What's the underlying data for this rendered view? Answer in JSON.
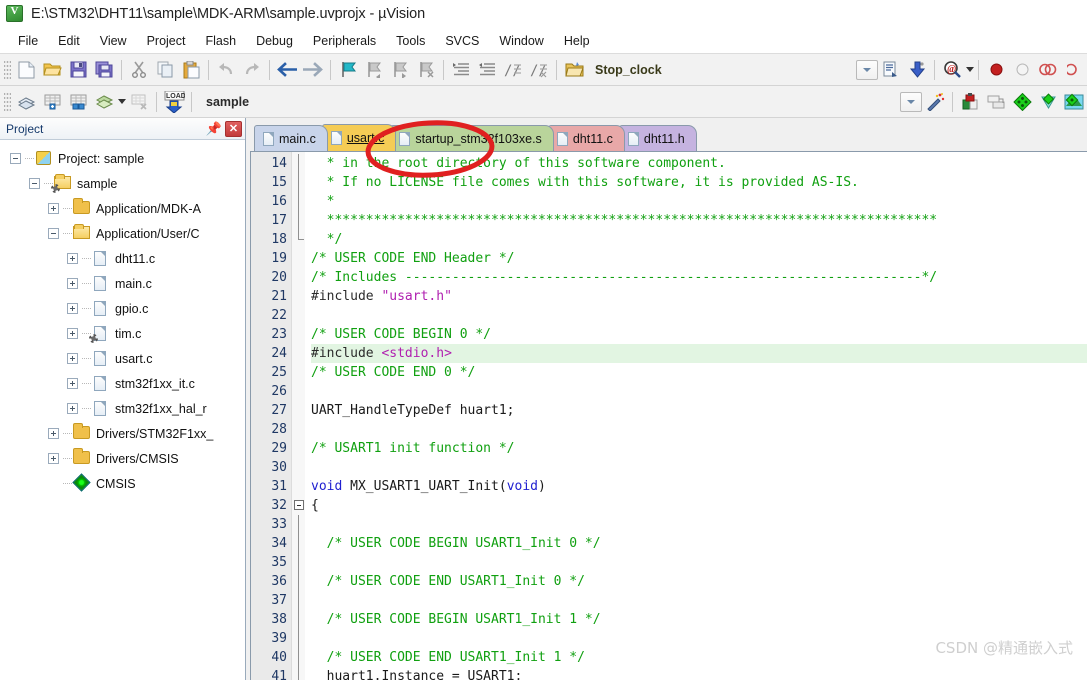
{
  "window": {
    "title": "E:\\STM32\\DHT11\\sample\\MDK-ARM\\sample.uvprojx - µVision",
    "app_icon": "uvision-logo-icon"
  },
  "menubar": {
    "items": [
      "File",
      "Edit",
      "View",
      "Project",
      "Flash",
      "Debug",
      "Peripherals",
      "Tools",
      "SVCS",
      "Window",
      "Help"
    ]
  },
  "toolbar_row1": {
    "icons": [
      "new-file-icon",
      "open-folder-icon",
      "save-icon",
      "save-all-icon",
      "cut-icon",
      "copy-icon",
      "paste-icon",
      "undo-icon",
      "redo-icon",
      "navigate-back-icon",
      "navigate-forward-icon",
      "bookmark-toggle-icon",
      "bookmark-prev-icon",
      "bookmark-next-icon",
      "bookmark-clear-icon",
      "indent-icon",
      "outdent-icon",
      "comment-icon",
      "uncomment-icon",
      "target-options-icon"
    ],
    "target_label": "Stop_clock",
    "combo_chevron": "chevron-down-icon",
    "right_icons": [
      "build-output-icon",
      "download-icon",
      "find-in-files-icon",
      "debug-start-icon",
      "debug-reset-icon",
      "breakpoint-icon"
    ]
  },
  "toolbar_row2": {
    "icons": [
      "build-icon",
      "build-target-icon",
      "rebuild-icon",
      "batch-build-icon",
      "stop-build-icon",
      "load-icon"
    ],
    "load_label": "LOAD",
    "target_name": "sample",
    "right_icons": [
      "magic-wand-icon",
      "manage-project-items-icon",
      "multi-project-icon",
      "pack-installer-icon",
      "configuration-wizard-icon",
      "rte-manager-icon"
    ]
  },
  "project_pane": {
    "title": "Project",
    "pin_icon": "pin-icon",
    "close_icon": "close-icon",
    "tree": [
      {
        "label": "Project: sample",
        "depth": 0,
        "icon": "project-icon",
        "expander": "minus"
      },
      {
        "label": "sample",
        "depth": 1,
        "icon": "folder-open-icon",
        "expander": "minus",
        "gear": true
      },
      {
        "label": "Application/MDK-A",
        "depth": 2,
        "icon": "folder-icon",
        "expander": "plus"
      },
      {
        "label": "Application/User/C",
        "depth": 2,
        "icon": "folder-open-icon",
        "expander": "minus"
      },
      {
        "label": "dht11.c",
        "depth": 3,
        "icon": "file-icon",
        "expander": "plus"
      },
      {
        "label": "main.c",
        "depth": 3,
        "icon": "file-icon",
        "expander": "plus"
      },
      {
        "label": "gpio.c",
        "depth": 3,
        "icon": "file-icon",
        "expander": "plus"
      },
      {
        "label": "tim.c",
        "depth": 3,
        "icon": "file-icon",
        "expander": "plus",
        "gear": true
      },
      {
        "label": "usart.c",
        "depth": 3,
        "icon": "file-icon",
        "expander": "plus"
      },
      {
        "label": "stm32f1xx_it.c",
        "depth": 3,
        "icon": "file-icon",
        "expander": "plus"
      },
      {
        "label": "stm32f1xx_hal_r",
        "depth": 3,
        "icon": "file-icon",
        "expander": "plus"
      },
      {
        "label": "Drivers/STM32F1xx_",
        "depth": 2,
        "icon": "folder-icon",
        "expander": "plus"
      },
      {
        "label": "Drivers/CMSIS",
        "depth": 2,
        "icon": "folder-icon",
        "expander": "plus"
      },
      {
        "label": "CMSIS",
        "depth": 2,
        "icon": "cmsis-diamond-icon",
        "expander": "none"
      }
    ]
  },
  "editor": {
    "tabs": [
      {
        "label": "main.c",
        "active": false,
        "color": "#c8d4ea"
      },
      {
        "label": "usart.c",
        "active": true,
        "color": "#f5cc55"
      },
      {
        "label": "startup_stm32f103xe.s",
        "active": false,
        "color": "#b9d49b"
      },
      {
        "label": "dht11.c",
        "active": false,
        "color": "#e8a8a8"
      },
      {
        "label": "dht11.h",
        "active": false,
        "color": "#c5b3e0"
      }
    ],
    "first_line": 14,
    "highlight_line": 24,
    "lines": [
      {
        "n": 14,
        "fold": "bar",
        "tokens": [
          {
            "t": "  * in the root directory of this software component.",
            "c": "c-cmt"
          }
        ]
      },
      {
        "n": 15,
        "fold": "bar",
        "tokens": [
          {
            "t": "  * If no LICENSE file comes with this software, it is provided AS-IS.",
            "c": "c-cmt"
          }
        ]
      },
      {
        "n": 16,
        "fold": "bar",
        "tokens": [
          {
            "t": "  *",
            "c": "c-cmt"
          }
        ]
      },
      {
        "n": 17,
        "fold": "bar",
        "tokens": [
          {
            "t": "  ******************************************************************************",
            "c": "c-cmt"
          }
        ]
      },
      {
        "n": 18,
        "fold": "end",
        "tokens": [
          {
            "t": "  */",
            "c": "c-cmt"
          }
        ]
      },
      {
        "n": 19,
        "fold": "none",
        "tokens": [
          {
            "t": "/* USER CODE END Header */",
            "c": "c-cmt"
          }
        ]
      },
      {
        "n": 20,
        "fold": "none",
        "tokens": [
          {
            "t": "/* Includes ------------------------------------------------------------------*/",
            "c": "c-cmt"
          }
        ]
      },
      {
        "n": 21,
        "fold": "none",
        "tokens": [
          {
            "t": "#include ",
            "c": "c-pre"
          },
          {
            "t": "\"usart.h\"",
            "c": "c-str"
          }
        ]
      },
      {
        "n": 22,
        "fold": "none",
        "tokens": [
          {
            "t": "",
            "c": "c-txt"
          }
        ]
      },
      {
        "n": 23,
        "fold": "none",
        "tokens": [
          {
            "t": "/* USER CODE BEGIN 0 */",
            "c": "c-cmt"
          }
        ]
      },
      {
        "n": 24,
        "fold": "none",
        "hl": true,
        "tokens": [
          {
            "t": "#include ",
            "c": "c-pre"
          },
          {
            "t": "<stdio.h>",
            "c": "c-str"
          }
        ]
      },
      {
        "n": 25,
        "fold": "none",
        "tokens": [
          {
            "t": "/* USER CODE END 0 */",
            "c": "c-cmt"
          }
        ]
      },
      {
        "n": 26,
        "fold": "none",
        "tokens": [
          {
            "t": "",
            "c": "c-txt"
          }
        ]
      },
      {
        "n": 27,
        "fold": "none",
        "tokens": [
          {
            "t": "UART_HandleTypeDef huart1;",
            "c": "c-txt"
          }
        ]
      },
      {
        "n": 28,
        "fold": "none",
        "tokens": [
          {
            "t": "",
            "c": "c-txt"
          }
        ]
      },
      {
        "n": 29,
        "fold": "none",
        "tokens": [
          {
            "t": "/* USART1 init function */",
            "c": "c-cmt"
          }
        ]
      },
      {
        "n": 30,
        "fold": "none",
        "tokens": [
          {
            "t": "",
            "c": "c-txt"
          }
        ]
      },
      {
        "n": 31,
        "fold": "none",
        "tokens": [
          {
            "t": "void ",
            "c": "c-kw"
          },
          {
            "t": "MX_USART1_UART_Init(",
            "c": "c-txt"
          },
          {
            "t": "void",
            "c": "c-kw"
          },
          {
            "t": ")",
            "c": "c-txt"
          }
        ]
      },
      {
        "n": 32,
        "fold": "box",
        "tokens": [
          {
            "t": "{",
            "c": "c-txt"
          }
        ]
      },
      {
        "n": 33,
        "fold": "bar",
        "tokens": [
          {
            "t": "",
            "c": "c-txt"
          }
        ]
      },
      {
        "n": 34,
        "fold": "bar",
        "tokens": [
          {
            "t": "  /* USER CODE BEGIN USART1_Init 0 */",
            "c": "c-cmt"
          }
        ]
      },
      {
        "n": 35,
        "fold": "bar",
        "tokens": [
          {
            "t": "",
            "c": "c-txt"
          }
        ]
      },
      {
        "n": 36,
        "fold": "bar",
        "tokens": [
          {
            "t": "  /* USER CODE END USART1_Init 0 */",
            "c": "c-cmt"
          }
        ]
      },
      {
        "n": 37,
        "fold": "bar",
        "tokens": [
          {
            "t": "",
            "c": "c-txt"
          }
        ]
      },
      {
        "n": 38,
        "fold": "bar",
        "tokens": [
          {
            "t": "  /* USER CODE BEGIN USART1_Init 1 */",
            "c": "c-cmt"
          }
        ]
      },
      {
        "n": 39,
        "fold": "bar",
        "tokens": [
          {
            "t": "",
            "c": "c-txt"
          }
        ]
      },
      {
        "n": 40,
        "fold": "bar",
        "tokens": [
          {
            "t": "  /* USER CODE END USART1_Init 1 */",
            "c": "c-cmt"
          }
        ]
      },
      {
        "n": 41,
        "fold": "bar",
        "tokens": [
          {
            "t": "  huart1.Instance = USART1;",
            "c": "c-txt"
          }
        ]
      }
    ]
  },
  "annotation": {
    "shape": "red-ellipse-highlight",
    "color": "#e02020",
    "target": "usart.c"
  },
  "watermark": {
    "text": "CSDN @精通嵌入式"
  },
  "colors": {
    "accent": "#1f3864",
    "comment_green": "#10a010",
    "string_magenta": "#b020b0",
    "keyword_blue": "#2020d0",
    "active_tab": "#f5cc55",
    "highlight_line_bg": "#e2f5e2"
  }
}
